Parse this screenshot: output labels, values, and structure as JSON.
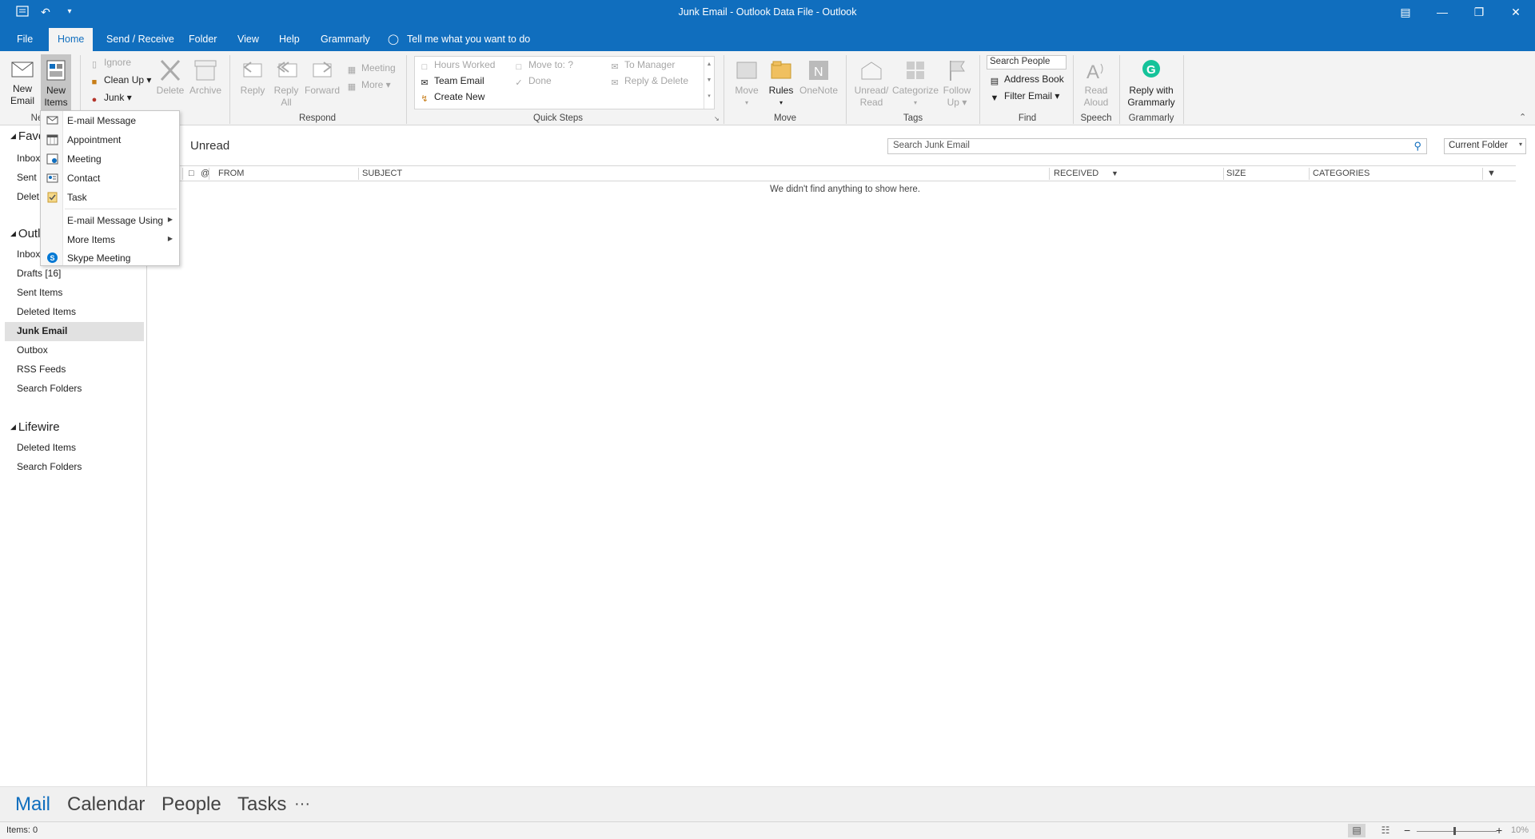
{
  "window": {
    "title": "Junk Email - Outlook Data File  -  Outlook"
  },
  "menu_tabs": [
    "File",
    "Home",
    "Send / Receive",
    "Folder",
    "View",
    "Help",
    "Grammarly"
  ],
  "tell_me": "Tell me what you want to do",
  "ribbon": {
    "new_email": [
      "New",
      "Email"
    ],
    "new_items": [
      "New",
      "Items"
    ],
    "group_new_partial": "Ne",
    "ignore": "Ignore",
    "clean_up": "Clean Up",
    "junk": "Junk",
    "delete": "Delete",
    "archive": "Archive",
    "reply": "Reply",
    "reply_all": [
      "Reply",
      "All"
    ],
    "forward": "Forward",
    "meeting": "Meeting",
    "more": "More",
    "respond_group": "Respond",
    "quick_steps": {
      "items": [
        "Hours Worked",
        "Team Email",
        "Create New",
        "Move to: ?",
        "Done",
        "To Manager",
        "Reply & Delete"
      ],
      "group": "Quick Steps"
    },
    "move": "Move",
    "rules": "Rules",
    "onenote": "OneNote",
    "move_group": "Move",
    "unread_read": [
      "Unread/",
      "Read"
    ],
    "categorize": "Categorize",
    "follow_up": [
      "Follow",
      "Up"
    ],
    "tags_group": "Tags",
    "search_people": "Search People",
    "address_book": "Address Book",
    "filter_email": "Filter Email",
    "find_group": "Find",
    "read_aloud": [
      "Read",
      "Aloud"
    ],
    "speech_group": "Speech",
    "reply_grammarly": [
      "Reply with",
      "Grammarly"
    ],
    "grammarly_group": "Grammarly"
  },
  "new_items_menu": {
    "items": [
      "E-mail Message",
      "Appointment",
      "Meeting",
      "Contact",
      "Task",
      "E-mail Message Using",
      "More Items",
      "Skype Meeting"
    ]
  },
  "nav": {
    "favorites_partial": "Favo",
    "fav_items": [
      "Inbox",
      "Sent I",
      "Delet"
    ],
    "account_partial": "Outl",
    "account_items": [
      "Inbox",
      "Drafts [16]",
      "Sent Items",
      "Deleted Items",
      "Junk Email",
      "Outbox",
      "RSS Feeds",
      "Search Folders"
    ],
    "lifewire": "Lifewire",
    "lifewire_items": [
      "Deleted Items",
      "Search Folders"
    ]
  },
  "list": {
    "filter_label": "Unread",
    "search_placeholder": "Search Junk Email",
    "scope": "Current Folder",
    "columns": [
      "FROM",
      "SUBJECT",
      "RECEIVED",
      "SIZE",
      "CATEGORIES"
    ],
    "empty_message": "We didn't find anything to show here."
  },
  "bottom_nav": [
    "Mail",
    "Calendar",
    "People",
    "Tasks",
    "···"
  ],
  "status": {
    "items": "Items: 0",
    "zoom": "10%"
  },
  "colors": {
    "accent": "#106ebe",
    "ribbon_bg": "#f3f3f3",
    "selected_bg": "#e1e1e1"
  }
}
